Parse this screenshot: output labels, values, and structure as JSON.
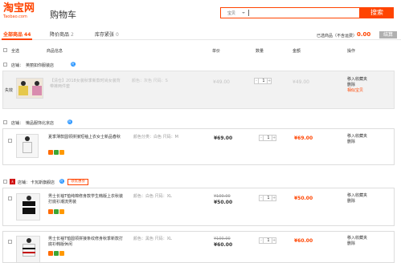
{
  "header": {
    "logo_main": "淘宝网",
    "logo_sub": "Taobao.com",
    "page_title": "购物车",
    "search_scope": "宝贝",
    "search_button": "搜索"
  },
  "tabs": [
    {
      "label": "全部商品",
      "count": "44"
    },
    {
      "label": "降价商品",
      "count": "2"
    },
    {
      "label": "库存紧张",
      "count": "0"
    }
  ],
  "summary": {
    "selected_text": "已选商品（不含运费）",
    "total": "0.00",
    "settle_label": "结算"
  },
  "columns": {
    "select_all": "全选",
    "product": "商品信息",
    "price": "单价",
    "quantity": "数量",
    "amount": "金额",
    "operations": "操作"
  },
  "shops": [
    {
      "label": "店铺：",
      "name": "英丽如你服装店",
      "badge": "旺"
    },
    {
      "label": "店铺：",
      "name": "懒品服饰北京店",
      "badge": "旺"
    },
    {
      "label": "店铺：",
      "name": "卡瓦斯旗舰店",
      "badge": "旺",
      "promo": "领优惠券",
      "logo_text": "天"
    }
  ],
  "items": [
    {
      "status": "失效",
      "title": "【清仓】2018女装秋季新款时尚女装背带裤两件套",
      "sku": "颜色：灰色 尺码：S",
      "price": "¥49.00",
      "quantity": "1",
      "amount": "¥49.00",
      "ops": [
        "移入收藏夹",
        "删除",
        "相似宝贝"
      ]
    },
    {
      "title": "夏季薄款圆领拼接短袖上衣女士新品春秋",
      "sku": "颜色分类：白色 尺码：M",
      "price": "¥69.00",
      "quantity": "1",
      "amount": "¥69.00",
      "ops": [
        "移入收藏夹",
        "删除"
      ]
    },
    {
      "title": "男士长袖T恤纯棉修身款学生韩版上衣秋装打底衫潮流男装",
      "sku": "颜色：白色 尺码：XL",
      "price_old": "¥100.00",
      "price": "¥50.00",
      "quantity": "1",
      "amount": "¥50.00",
      "ops": [
        "移入收藏夹",
        "删除"
      ]
    },
    {
      "title": "男士长袖T恤圆领拼接条纹修身秋季新款打底衫韩版休闲",
      "sku": "颜色：黑色 尺码：XL",
      "price_old": "¥100.00",
      "price": "¥60.00",
      "quantity": "1",
      "amount": "¥60.00",
      "ops": [
        "移入收藏夹",
        "删除"
      ]
    }
  ]
}
